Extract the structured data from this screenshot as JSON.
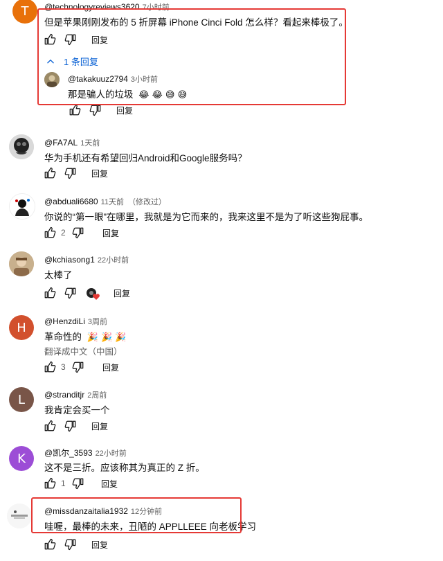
{
  "labels": {
    "reply": "回复"
  },
  "colors": {
    "accent_blue": "#065fd4",
    "highlight_red": "#e53935",
    "avatar_orange": "#e8710a",
    "avatar_brown": "#a0522d",
    "avatar_gray": "#6b6b6b",
    "avatar_purple": "#9c4dd6"
  },
  "comments": [
    {
      "avatar_letter": "T",
      "handle": "@technologyreviews3620",
      "time": "7小时前",
      "text": "但是苹果刚刚发布的 5 折屏幕 iPhone Cinci Fold 怎么样？看起来棒极了。",
      "replies_toggle": "1 条回复",
      "reply": {
        "handle": "@takakuuz2794",
        "time": "3小时前",
        "text": "那是骗人的垃圾",
        "emojis": "😂 😂 😅 😅"
      }
    },
    {
      "handle": "@FA7AL",
      "time": "1天前",
      "text": "华为手机还有希望回归Android和Google服务吗？"
    },
    {
      "handle": "@abduali6680",
      "time": "11天前",
      "edited": "（修改过）",
      "text": "你说的“第一眼”在哪里，我就是为它而来的，我来这里不是为了听这些狗屁事。",
      "likes": "2"
    },
    {
      "handle": "@kchiasong1",
      "time": "22小时前",
      "text": "太棒了"
    },
    {
      "avatar_letter": "H",
      "handle": "@HenzdiLi",
      "time": "3周前",
      "text": "革命性的",
      "emojis": "🎉 🎉 🎉",
      "translate": "翻译成中文（中国）",
      "likes": "3"
    },
    {
      "avatar_letter": "L",
      "handle": "@stranditjr",
      "time": "2周前",
      "text": "我肯定会买一个"
    },
    {
      "avatar_letter": "K",
      "handle": "@凯尔_3593",
      "time": "22小时前",
      "text": "这不是三折。应该称其为真正的 Z 折。",
      "likes": "1"
    },
    {
      "handle": "@missdanzaitalia1932",
      "time": "12分钟前",
      "text": "哇喔，最棒的未来，丑陋的 APPLLEEE 向老板学习"
    }
  ]
}
